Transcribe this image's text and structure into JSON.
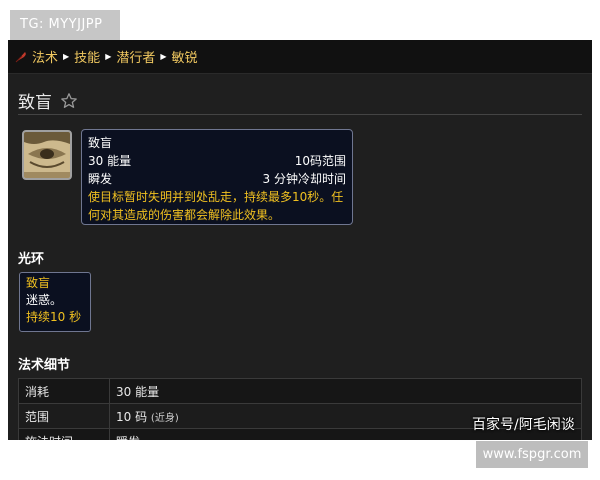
{
  "watermark_tag": "TG: MYYJJPP",
  "breadcrumb": {
    "items": [
      "法术",
      "技能",
      "潜行者",
      "敏锐"
    ],
    "icon": "feather-quill-icon"
  },
  "spell": {
    "title": "致盲",
    "favorite_icon": "star-outline-icon"
  },
  "tooltip": {
    "name": "致盲",
    "cost": "30 能量",
    "range": "10码范围",
    "cast": "瞬发",
    "cooldown": "3 分钟冷却时间",
    "description": "使目标暂时失明并到处乱走，持续最多10秒。任何对其造成的伤害都会解除此效果。"
  },
  "aura": {
    "heading": "光环",
    "name": "致盲",
    "effect": "迷惑。",
    "duration": "持续10 秒"
  },
  "details": {
    "heading": "法术细节",
    "rows": [
      {
        "label": "消耗",
        "value": "30 能量",
        "note": ""
      },
      {
        "label": "范围",
        "value": "10 码",
        "note": "(近身)"
      },
      {
        "label": "施法时间",
        "value": "瞬发",
        "note": ""
      }
    ]
  },
  "overlay_watermark": "百家号/阿毛闲谈",
  "site_label": "www.fspgr.com",
  "colors": {
    "gold": "#f0c860",
    "tooltip_bg": "#0b1020",
    "panel_bg": "#1f1f1f"
  }
}
